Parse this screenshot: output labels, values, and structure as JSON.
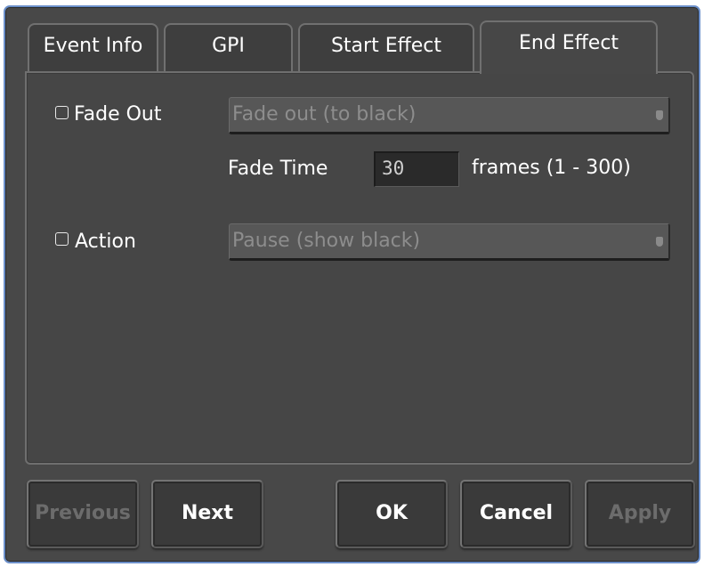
{
  "tabs": [
    {
      "label": "Event Info",
      "active": false
    },
    {
      "label": "GPI",
      "active": false
    },
    {
      "label": "Start Effect",
      "active": false
    },
    {
      "label": "End Effect",
      "active": true
    }
  ],
  "fade_out": {
    "checkbox_label": "Fade Out",
    "checked": false,
    "dropdown_value": "Fade out (to black)",
    "fade_time_label": "Fade Time",
    "fade_time_value": "30",
    "frames_hint": "frames (1 - 300)"
  },
  "action": {
    "checkbox_label": "Action",
    "checked": false,
    "dropdown_value": "Pause (show black)"
  },
  "buttons": {
    "previous": "Previous",
    "next": "Next",
    "ok": "OK",
    "cancel": "Cancel",
    "apply": "Apply"
  },
  "colors": {
    "background": "#484848",
    "window_border": "#6b8fc9",
    "disabled_text": "#6c6c6c",
    "dropdown_text": "#8d8d8d"
  }
}
